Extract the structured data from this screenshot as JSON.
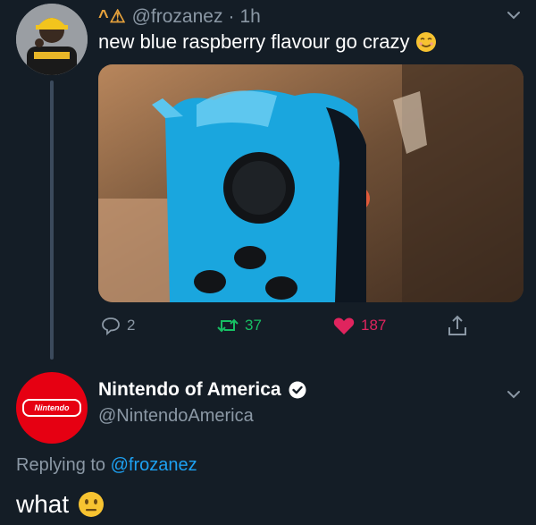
{
  "tweet": {
    "author_name_glyphs": "^⚠",
    "handle": "@frozanez",
    "separator": "·",
    "time": "1h",
    "text": "new blue raspberry flavour go crazy",
    "emoji": "smiling-face-icon",
    "media_alt": "photo of a bitten blue Joy-Con controller"
  },
  "actions": {
    "replies": "2",
    "retweets": "37",
    "likes": "187"
  },
  "reply": {
    "logo_text": "Nintendo",
    "name": "Nintendo of America",
    "handle": "@NintendoAmerica",
    "replying_prefix": "Replying to",
    "replying_to": "@frozanez",
    "text": "what",
    "emoji": "neutral-face-icon"
  },
  "colors": {
    "background": "#141d26",
    "secondary_text": "#8b98a5",
    "link": "#1da1f2",
    "retweet": "#17bf63",
    "like": "#e0245e",
    "nintendo_red": "#e60012"
  }
}
